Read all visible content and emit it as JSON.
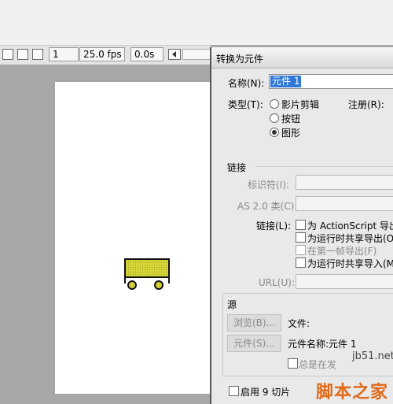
{
  "timeline": {
    "frame": "1",
    "fps": "25.0 fps",
    "time": "0.0s"
  },
  "dialog": {
    "title": "转换为元件",
    "name_label": "名称(N):",
    "name_value": "元件 1",
    "type_label": "类型(T):",
    "types": [
      "影片剪辑",
      "按钮",
      "图形"
    ],
    "selected_type": "图形",
    "register_label": "注册(R):",
    "linkage_section": "链接",
    "identifier_label": "标识符(I):",
    "as2_class_label": "AS 2.0 类(C):",
    "linkage_label": "链接(L):",
    "linkage_options": [
      "为 ActionScript 导出(X)",
      "为运行时共享导出(O)",
      "在第一帧导出(F)",
      "为运行时共享导入(M)"
    ],
    "url_label": "URL(U):",
    "source_section": "源",
    "browse_button": "浏览(B)...",
    "file_label": "文件:",
    "symbol_button": "元件(S)...",
    "symbol_name": "元件名称:元件 1",
    "always_update": "总是在发",
    "enable_9slice": "启用 9 切片"
  },
  "watermark": {
    "url": "jb51.net",
    "brand": "脚本之家"
  },
  "colors": {
    "selection": "#3278d8",
    "shape_fill": "#d8d83a",
    "brand": "#e06a18"
  }
}
